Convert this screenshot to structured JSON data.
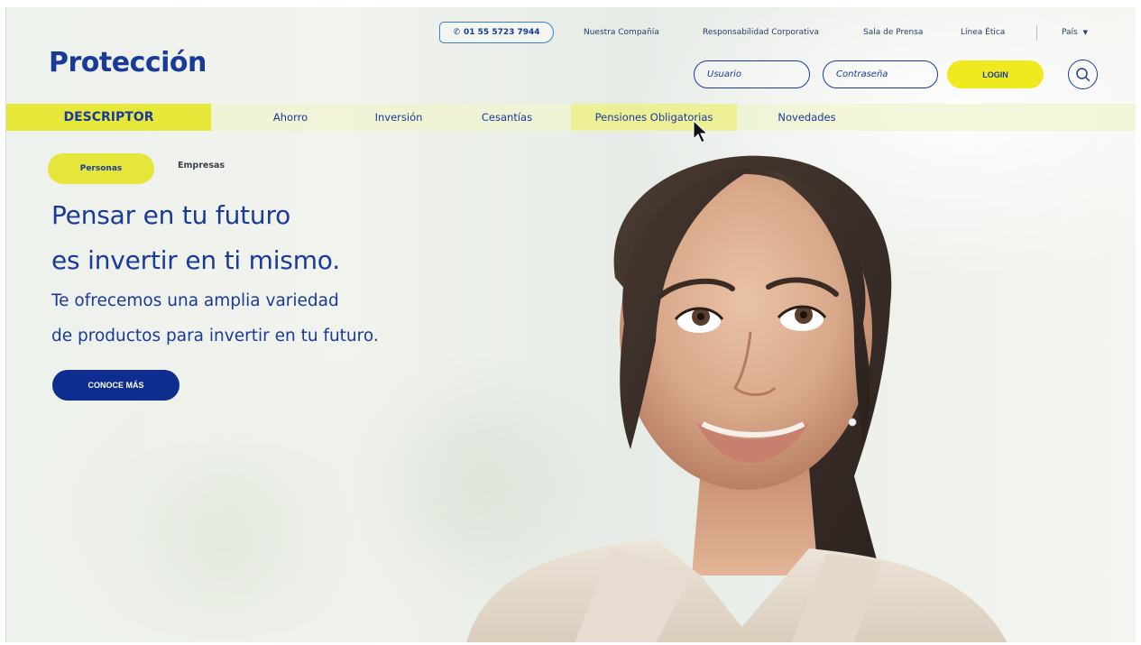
{
  "brand": {
    "logo_text": "Protección",
    "primary_color": "#1a3a9a",
    "accent_color": "#eeea1f"
  },
  "header": {
    "phone": {
      "icon": "phone-icon",
      "number": "01 55 5723 7944"
    },
    "top_links": [
      {
        "label": "Nuestra Compañía"
      },
      {
        "label": "Responsabilidad Corporativa"
      },
      {
        "label": "Sala de Prensa"
      },
      {
        "label": "Línea Ética"
      }
    ],
    "country": {
      "label": "País",
      "icon": "chevron-down-icon"
    },
    "login": {
      "user_placeholder": "Usuario",
      "password_placeholder": "Contraseña",
      "button_label": "LOGIN"
    },
    "search": {
      "icon": "search-icon"
    }
  },
  "nav": {
    "descriptor_label": "DESCRIPTOR",
    "items": [
      {
        "label": "Ahorro"
      },
      {
        "label": "Inversión"
      },
      {
        "label": "Cesantías"
      },
      {
        "label": "Pensiones Obligatorias",
        "active": true
      },
      {
        "label": "Novedades"
      }
    ]
  },
  "segments": {
    "personas": "Personas",
    "empresas": "Empresas",
    "selected": "Personas"
  },
  "hero": {
    "line1": "Pensar en tu futuro",
    "line2": "es invertir en ti mismo.",
    "sub1": "Te ofrecemos una amplia variedad",
    "sub2": "de productos para invertir en tu futuro.",
    "cta_label": "CONOCE MÁS"
  }
}
